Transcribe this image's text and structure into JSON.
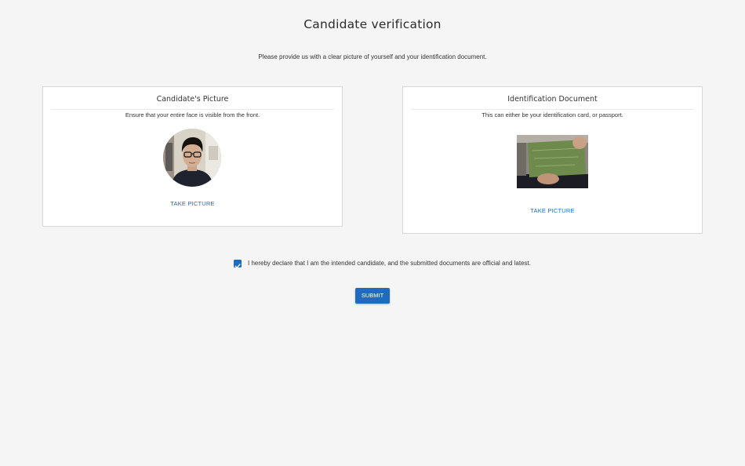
{
  "header": {
    "title": "Candidate verification",
    "subtitle": "Please provide us with a clear picture of yourself and your identification document."
  },
  "candidate_card": {
    "title": "Candidate's Picture",
    "description": "Ensure that your entire face is visible from the front.",
    "button_label": "TAKE PICTURE"
  },
  "document_card": {
    "title": "Identification Document",
    "description": "This can either be your identification card, or passport.",
    "button_label": "TAKE PICTURE"
  },
  "declaration": {
    "checked": true,
    "text": "I hereby declare that I am the intended candidate, and the submitted documents are official and latest."
  },
  "submit": {
    "label": "SUBMIT"
  },
  "colors": {
    "accent": "#1e6bbf",
    "background": "#f5f5f5"
  }
}
